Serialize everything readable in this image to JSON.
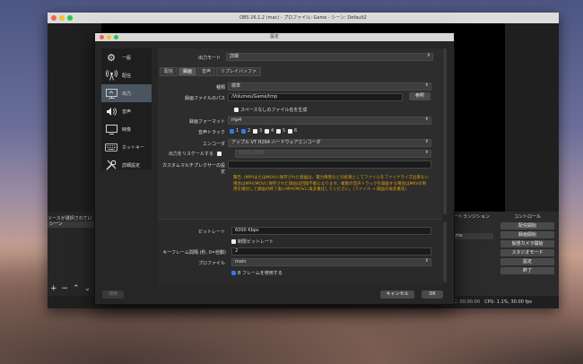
{
  "obs": {
    "title": "OBS 26.1.2 (mac) - プロファイル: Game - シーン: Default2",
    "sources_header": "ソースが選択されてい",
    "scene_item": "シーン",
    "transition_label": "ートランジション",
    "transition_ms": "ms",
    "controls_label": "コントロール",
    "controls": [
      "配信開始",
      "録画開始",
      "仮想カメラ開始",
      "スタジオモード",
      "設定",
      "終了"
    ],
    "status_rec": "REC: 00:00:00",
    "status_cpu": "CPU: 1.1%, 30.00 fps"
  },
  "settings": {
    "title": "設定",
    "sidebar": [
      {
        "label": "一般",
        "icon": "gear-icon"
      },
      {
        "label": "配信",
        "icon": "broadcast-icon"
      },
      {
        "label": "出力",
        "icon": "output-icon"
      },
      {
        "label": "音声",
        "icon": "speaker-icon"
      },
      {
        "label": "映像",
        "icon": "monitor-icon"
      },
      {
        "label": "ホットキー",
        "icon": "keyboard-icon"
      },
      {
        "label": "詳細設定",
        "icon": "tools-icon"
      }
    ],
    "output_mode_label": "出力モード",
    "output_mode_value": "詳細",
    "tabs": [
      "配信",
      "録画",
      "音声",
      "リプレイバッファ"
    ],
    "type_label": "種類",
    "type_value": "標準",
    "path_label": "録画ファイルのパス",
    "path_value": "/Volumes/Game/tmp",
    "browse_button": "参照",
    "no_space_label": "スペースなしのファイル名を生成",
    "format_label": "録画フォーマット",
    "format_value": "mp4",
    "audio_track_label": "音声トラック",
    "audio_tracks": [
      "1",
      "2",
      "3",
      "4",
      "5",
      "6"
    ],
    "encoder_label": "エンコーダ",
    "encoder_value": "アップル VT H264 ハードウェアエンコーダ",
    "rescale_label": "出力をリスケールする",
    "rescale_value": "1920x1080",
    "muxer_label": "カスタムマルチプレクサーの設定",
    "warning": "警告: (MP4またはMOVに保存された録画は、電力障害などの結果としてファイルをファイナライズ出来ない場合はMP4/MOVに保存された録画は回復不能になります。複数の音声トラックを録画する場合はMKVの利用を検討して録画の終了後にMP4/MOVに再多重化してください。(ファイル → 録画の再多重化)",
    "bitrate_label": "ビットレート",
    "bitrate_value": "6000 Kbps",
    "limit_bitrate_label": "制限ビットレート",
    "keyframe_label": "キーフレーム間隔 (秒, 0=自動)",
    "keyframe_value": "2",
    "profile_label": "プロファイル",
    "profile_value": "main",
    "bframes_label": "B フレームを使用する",
    "apply_button": "適用",
    "cancel_button": "キャンセル",
    "ok_button": "OK"
  }
}
